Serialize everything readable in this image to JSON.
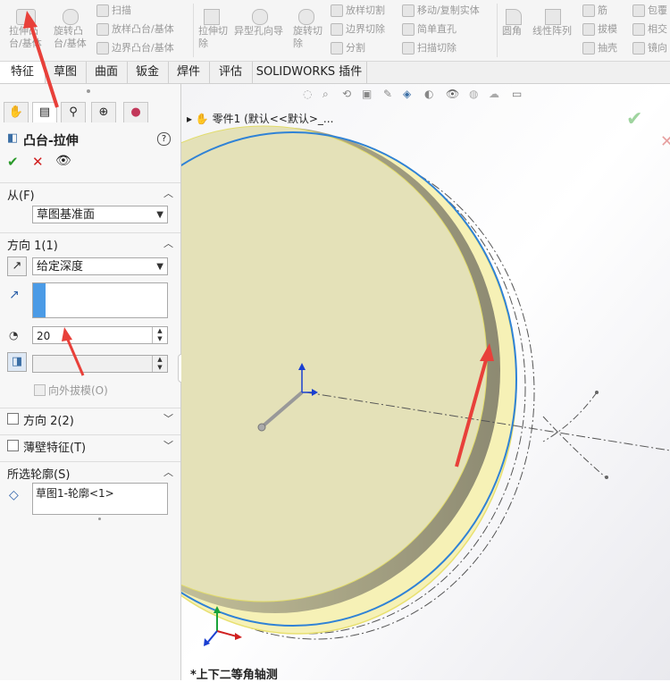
{
  "ribbon": {
    "groups": [
      {
        "items": [
          "拉伸凸",
          "台/基体"
        ]
      },
      {
        "items": [
          "旋转凸",
          "台/基体"
        ]
      },
      {
        "items": [
          "扫描",
          "放样凸台/基体",
          "边界凸台/基体"
        ]
      },
      {
        "items": [
          "拉伸切",
          "除"
        ]
      },
      {
        "items": [
          "异型孔向导"
        ]
      },
      {
        "items": [
          "旋转切",
          "除"
        ]
      },
      {
        "items": [
          "放样切割",
          "边界切除",
          "分割"
        ]
      },
      {
        "items": [
          "移动/复制实体",
          "简单直孔",
          "扫描切除"
        ]
      },
      {
        "items": [
          "圆角"
        ]
      },
      {
        "items": [
          "线性阵列"
        ]
      },
      {
        "items": [
          "筋",
          "拔模",
          "抽壳"
        ]
      },
      {
        "items": [
          "包覆",
          "相交",
          "镜向"
        ]
      }
    ]
  },
  "tabs": [
    "特征",
    "草图",
    "曲面",
    "钣金",
    "焊件",
    "评估",
    "SOLIDWORKS 插件"
  ],
  "panel": {
    "title": "凸台-拉伸",
    "help": "?",
    "ok": "✔",
    "cancel": "✕",
    "from_section": "从(F)",
    "from_value": "草图基准面",
    "dir1_section": "方向 1(1)",
    "dir1_type": "给定深度",
    "depth_value": "20",
    "draft_outward": "向外拔模(O)",
    "dir2_section": "方向 2(2)",
    "thin_section": "薄壁特征(T)",
    "contours_section": "所选轮廓(S)",
    "contour_item": "草图1-轮廓<1>"
  },
  "tree": {
    "label": "零件1  (默认<<默认>_..."
  },
  "viewport": {
    "view_label": "*上下二等角轴测"
  },
  "colors": {
    "accent_blue": "#2f82d6",
    "face": "#e4e1b8",
    "arrow_red": "#e8403a"
  }
}
